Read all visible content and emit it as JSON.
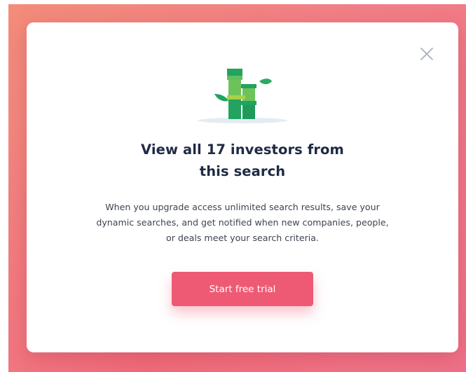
{
  "modal": {
    "title_line1": "View all 17 investors from",
    "title_line2": "this search",
    "description_line1": "When you upgrade access unlimited search results, save your",
    "description_line2": "dynamic searches, and get notified when new companies, people,",
    "description_line3": "or deals meet your search criteria.",
    "cta_label": "Start free trial",
    "close_icon": "close-icon",
    "illustration_icon": "bamboo-icon"
  },
  "colors": {
    "backdrop_start": "#f38c7a",
    "backdrop_end": "#ef7088",
    "cta": "#ee5a74",
    "title": "#1f2a44",
    "bamboo_dark": "#22a35f",
    "bamboo_light": "#6ec25a",
    "bamboo_lime": "#a9d14a"
  }
}
